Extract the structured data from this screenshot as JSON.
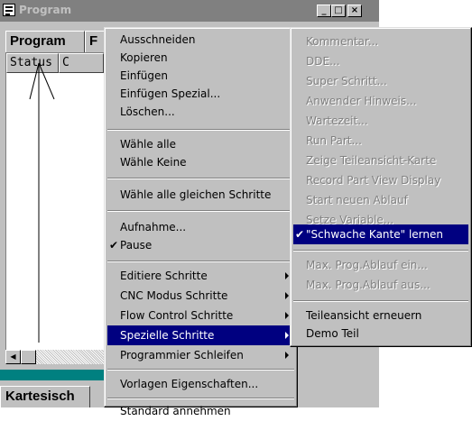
{
  "window": {
    "title": "Program",
    "buttons": {
      "minimize": "_",
      "maximize": "□",
      "close": "×"
    }
  },
  "tabs": {
    "program": "Program",
    "f_partial": "F"
  },
  "columns": {
    "status": "Status",
    "c_partial": "C"
  },
  "bottom_tab": "Kartesisch",
  "edit_menu": [
    {
      "label": "Ausschneiden"
    },
    {
      "label": "Kopieren"
    },
    {
      "label": "Einfügen"
    },
    {
      "label": "Einfügen Spezial..."
    },
    {
      "label": "Löschen..."
    },
    {
      "label": "Wähle alle"
    },
    {
      "label": "Wähle Keine"
    },
    {
      "label": "Wähle alle gleichen Schritte"
    },
    {
      "label": "Aufnahme..."
    },
    {
      "label": "Pause",
      "checked": true
    },
    {
      "label": "Editiere Schritte",
      "submenu": true
    },
    {
      "label": "CNC Modus Schritte",
      "submenu": true
    },
    {
      "label": "Flow Control Schritte",
      "submenu": true
    },
    {
      "label": "Spezielle Schritte",
      "submenu": true,
      "selected": true
    },
    {
      "label": "Programmier Schleifen",
      "submenu": true
    },
    {
      "label": "Vorlagen Eigenschaften..."
    },
    {
      "label": "Standard annehmen"
    }
  ],
  "special_submenu": [
    {
      "label": "Kommentar...",
      "disabled": true
    },
    {
      "label": "DDE...",
      "disabled": true
    },
    {
      "label": "Super Schritt...",
      "disabled": true
    },
    {
      "label": "Anwender Hinweis...",
      "disabled": true
    },
    {
      "label": "Wartezeit...",
      "disabled": true
    },
    {
      "label": "Run Part...",
      "disabled": true
    },
    {
      "label": "Zeige Teileansicht-Karte",
      "disabled": true
    },
    {
      "label": "Record Part View Display",
      "disabled": true
    },
    {
      "label": "Start neuen Ablauf",
      "disabled": true
    },
    {
      "label": "Setze Variable...",
      "disabled": true
    },
    {
      "label": "\"Schwache Kante\" lernen",
      "checked": true,
      "selected": true
    },
    {
      "label": "Max. Prog.Ablauf ein...",
      "disabled": true
    },
    {
      "label": "Max. Prog.Ablauf aus...",
      "disabled": true
    },
    {
      "label": "Teileansicht erneuern"
    },
    {
      "label": "Demo Teil"
    }
  ],
  "colors": {
    "selection": "#000080",
    "face": "#c0c0c0",
    "titlebar_inactive": "#808080",
    "teal": "#008080"
  },
  "icons": [
    "app-icon",
    "minimize-icon",
    "maximize-icon",
    "close-icon",
    "submenu-arrow-icon",
    "checkmark-icon",
    "scroll-left-icon"
  ]
}
